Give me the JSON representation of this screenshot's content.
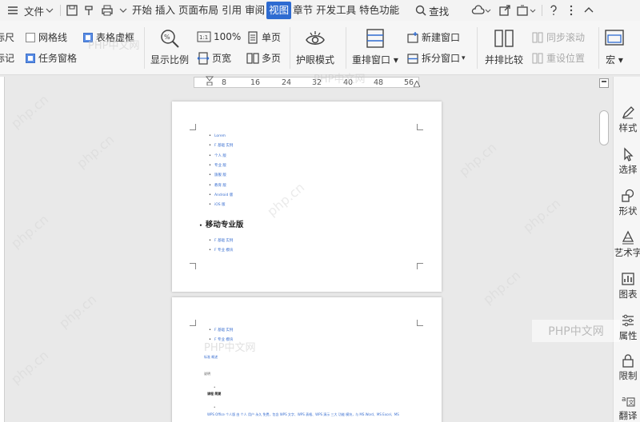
{
  "menubar": {
    "file_label": "文件",
    "tabs": [
      "开始",
      "插入",
      "页面布局",
      "引用",
      "审阅",
      "视图",
      "章节",
      "开发工具",
      "特色功能"
    ],
    "active_tab": "视图",
    "search_label": "查找"
  },
  "ribbon": {
    "ruler_label": "标尺",
    "gridlines_label": "网格线",
    "table_border_label": "表格虚框",
    "mark_label": "标记",
    "task_pane_label": "任务窗格",
    "zoom_ratio_label": "显示比例",
    "zoom_100": "100%",
    "page_width_label": "页宽",
    "single_page_label": "单页",
    "multi_page_label": "多页",
    "eye_mode_label": "护眼模式",
    "rearrange_label": "重排窗口",
    "new_window_label": "新建窗口",
    "split_window_label": "拆分窗口",
    "side_by_side_label": "并排比较",
    "sync_scroll_label": "同步滚动",
    "reset_position_label": "重设位置",
    "macro_label": "宏"
  },
  "ruler": {
    "labels": [
      "8",
      "16",
      "24",
      "32",
      "40",
      "48",
      "56"
    ]
  },
  "page1": {
    "bullets": [
      "Lorem",
      "F 基础 实例",
      "个人 版",
      "专业 版",
      "旗舰 版",
      "教育 版",
      "Android 版",
      "iOS 版"
    ],
    "heading": "移动专业版",
    "bullets2": [
      "F 基础 实例",
      "F 专业 模块"
    ]
  },
  "page2": {
    "bullets": [
      "F 基础 实例",
      "F 专业 模块"
    ],
    "label_a": "标准 概述",
    "label_b": "说明",
    "heading": "课程 简要",
    "line": "WPS Office 个人版 由 个人 用户 永久 免费，包含 WPS 文字、WPS 表格、WPS 演示 三大 功能 模块，与 MS Word、MS Excel、MS"
  },
  "right_panel": {
    "items": [
      "样式",
      "选择",
      "形状",
      "艺术字",
      "图表",
      "属性",
      "限制",
      "翻译"
    ]
  },
  "watermark": {
    "text": "PHP中文网",
    "diag": "php.cn"
  },
  "colors": {
    "accent": "#2e6bd1",
    "link": "#3a6fd0"
  }
}
